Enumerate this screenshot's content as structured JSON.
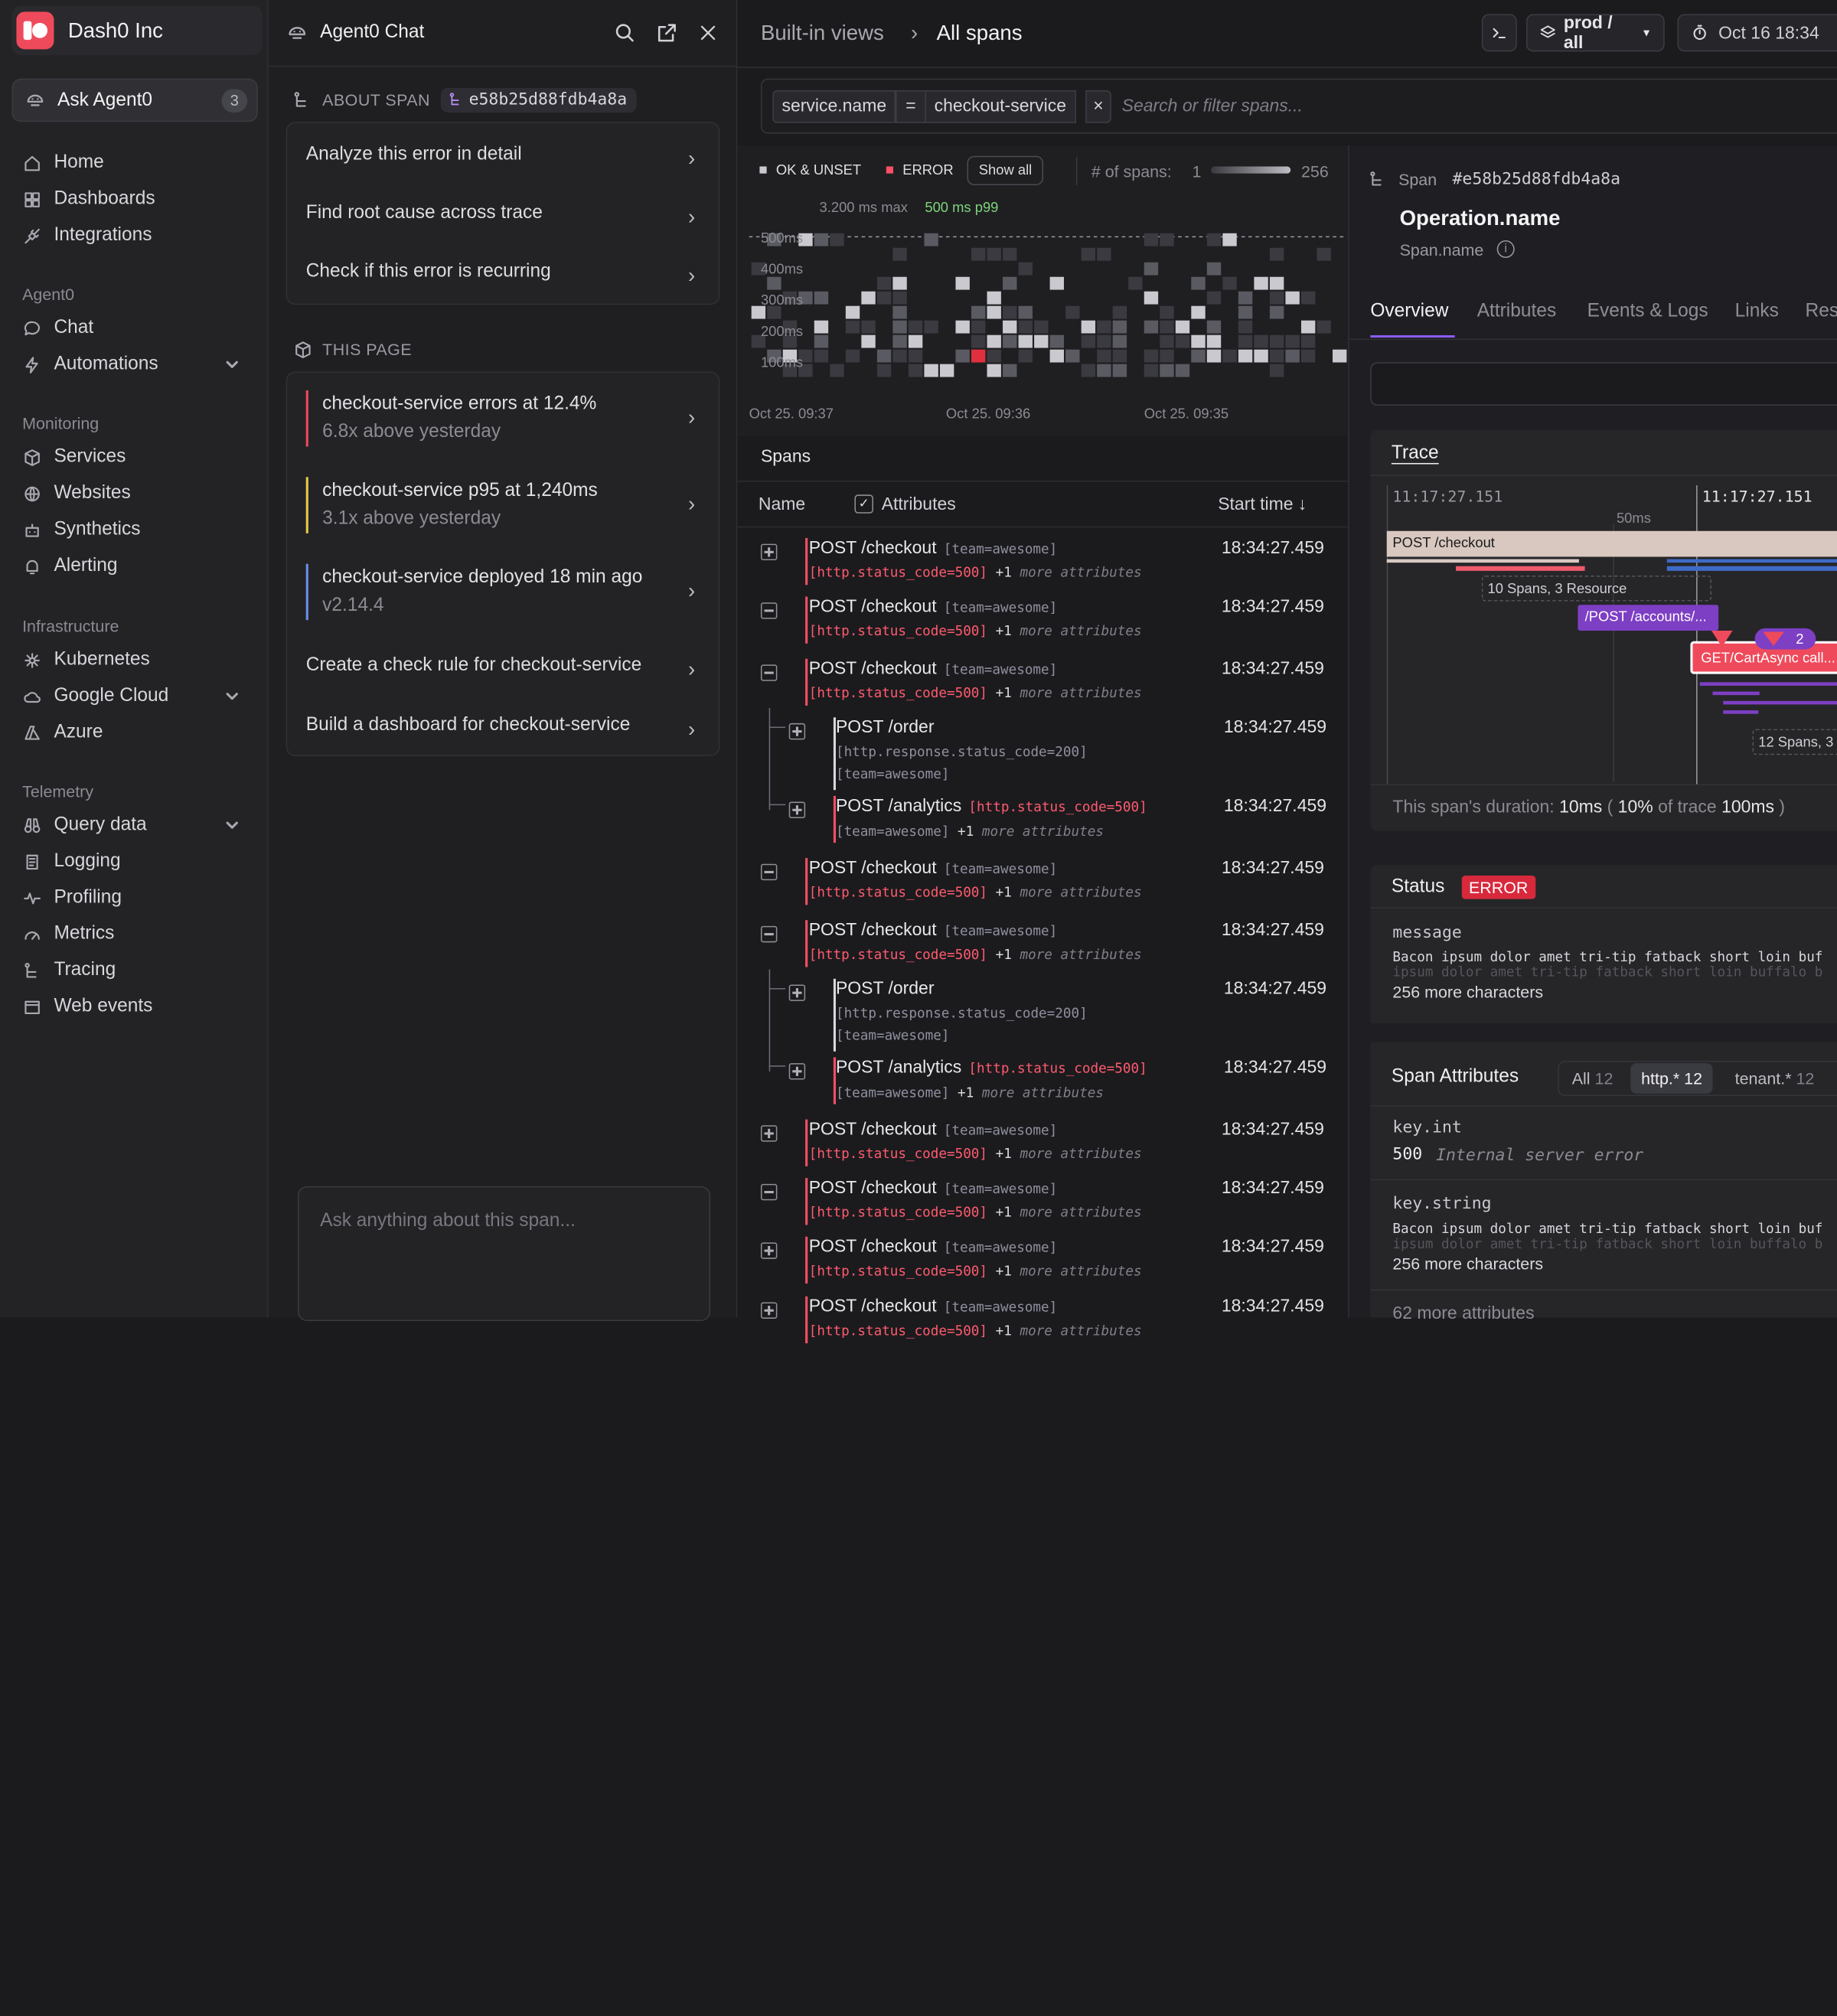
{
  "org": {
    "name": "Dash0 Inc"
  },
  "ask": {
    "label": "Ask Agent0",
    "count": "3"
  },
  "nav": {
    "top": [
      "Home",
      "Dashboards",
      "Integrations"
    ],
    "agent_section": "Agent0",
    "agent": [
      "Chat",
      "Automations"
    ],
    "monitoring_section": "Monitoring",
    "monitoring": [
      "Services",
      "Websites",
      "Synthetics",
      "Alerting"
    ],
    "infra_section": "Infrastructure",
    "infra": [
      "Kubernetes",
      "Google Cloud",
      "Azure"
    ],
    "telemetry_section": "Telemetry",
    "telemetry": [
      "Query data",
      "Logging",
      "Profiling",
      "Metrics",
      "Tracing",
      "Web events"
    ]
  },
  "chat": {
    "title": "Agent0 Chat",
    "about_label": "ABOUT SPAN",
    "span_id": "e58b25d88fdb4a8a",
    "suggestions": [
      "Analyze this error in detail",
      "Find root cause across trace",
      "Check if this error is recurring"
    ],
    "this_page_label": "THIS PAGE",
    "insights": [
      {
        "title": "checkout-service errors at 12.4%",
        "sub": "6.8x above yesterday",
        "color": "#ef4a5b"
      },
      {
        "title": "checkout-service p95 at 1,240ms",
        "sub": "3.1x above yesterday",
        "color": "#e8c94a"
      },
      {
        "title": "checkout-service deployed 18 min ago",
        "sub": "v2.14.4",
        "color": "#6b8fe8"
      }
    ],
    "actions": [
      "Create a check rule for checkout-service",
      "Build a dashboard for checkout-service"
    ],
    "input_placeholder": "Ask anything about this span..."
  },
  "header": {
    "crumb1": "Built-in views",
    "crumb2": "All spans",
    "env": "prod / all",
    "time": "Oct 16 18:34"
  },
  "filter": {
    "key": "service.name",
    "op": "=",
    "value": "checkout-service",
    "placeholder": "Search or filter spans..."
  },
  "chart": {
    "legend_ok": "OK & UNSET",
    "legend_err": "ERROR",
    "show_all": "Show all",
    "span_count_label": "# of spans:",
    "span_min": "1",
    "span_max": "256",
    "max_label": "3.200 ms max",
    "p99_label": "500 ms p99",
    "y_ticks": [
      "500ms",
      "400ms",
      "300ms",
      "200ms",
      "100ms"
    ],
    "x_ticks": [
      "Oct 25. 09:37",
      "Oct 25. 09:36",
      "Oct 25. 09:35"
    ]
  },
  "chart_data": {
    "type": "heatmap",
    "x": [
      "Oct 25. 09:37",
      "Oct 25. 09:36",
      "Oct 25. 09:35"
    ],
    "y": [
      "100ms",
      "200ms",
      "300ms",
      "400ms",
      "500ms"
    ],
    "series": [
      {
        "name": "OK & UNSET"
      },
      {
        "name": "ERROR"
      }
    ],
    "p99": "500 ms",
    "max": "3.200 ms"
  },
  "spans": {
    "heading": "Spans",
    "col_name": "Name",
    "col_attr": "Attributes",
    "col_start": "Start time",
    "tag_team": "[team=awesome]",
    "tag_500": "[http.status_code=500]",
    "tag_200": "[http.response.status_code=200]",
    "more": "+1",
    "more_text": "more attributes",
    "rows": [
      {
        "name": "POST /checkout",
        "time": "18:34:27.459"
      },
      {
        "name": "POST /checkout",
        "time": "18:34:27.459"
      },
      {
        "name": "POST /checkout",
        "time": "18:34:27.459"
      },
      {
        "name": "POST /order",
        "time": "18:34:27.459"
      },
      {
        "name": "POST /analytics",
        "time": "18:34:27.459"
      },
      {
        "name": "POST /checkout",
        "time": "18:34:27.459"
      },
      {
        "name": "POST /checkout",
        "time": "18:34:27.459"
      },
      {
        "name": "POST /order",
        "time": "18:34:27.459"
      },
      {
        "name": "POST /analytics",
        "time": "18:34:27.459"
      },
      {
        "name": "POST /checkout",
        "time": "18:34:27.459"
      },
      {
        "name": "POST /checkout",
        "time": "18:34:27.459"
      },
      {
        "name": "POST /checkout",
        "time": "18:34:27.459"
      },
      {
        "name": "POST /checkout",
        "time": "18:34:27.459"
      }
    ]
  },
  "detail": {
    "span_label": "Span",
    "span_id": "#e58b25d88fdb4a8a",
    "op_name": "Operation.name",
    "span_name": "Span.name",
    "tabs": [
      "Overview",
      "Attributes",
      "Events & Logs",
      "Links",
      "Res"
    ],
    "trace_title": "Trace",
    "t1": "11:17:27.151",
    "t2": "11:17:27.151",
    "t_mid": "50ms",
    "trace_root": "POST /checkout",
    "group1": "10 Spans, 3 Resource",
    "accounts": "/POST /accounts/...",
    "cart": "GET/CartAsync call...",
    "bubble_count": "2",
    "group2": "12 Spans, 3",
    "dur_prefix": "This span's duration:",
    "dur": "10ms",
    "dur_pct": "10%",
    "dur_mid": "of trace",
    "dur_trace": "100ms",
    "status_title": "Status",
    "status_badge": "ERROR",
    "msg_key": "message",
    "msg_val": "Bacon ipsum dolor amet tri-tip fatback short loin buf",
    "msg_val2": "ipsum dolor amet tri-tip fatback short loin buffalo b",
    "msg_more": "256 more characters",
    "attrs_title": "Span Attributes",
    "attr_tabs": [
      {
        "label": "All",
        "n": "12"
      },
      {
        "label": "http.*",
        "n": "12"
      },
      {
        "label": "tenant.*",
        "n": "12"
      }
    ],
    "k1": "key.int",
    "v1": "500",
    "v1note": "Internal server error",
    "k2": "key.string",
    "v2": "Bacon ipsum dolor amet tri-tip fatback short loin buf",
    "v2b": "ipsum dolor amet tri-tip fatback short loin buffalo b",
    "v2more": "256 more characters",
    "more_attrs": "62 more attributes"
  },
  "colors": {
    "accent": "#7d3fc4",
    "error": "#ff4f64",
    "ok": "#c9c9cf",
    "brand": "#ef4a5b"
  }
}
